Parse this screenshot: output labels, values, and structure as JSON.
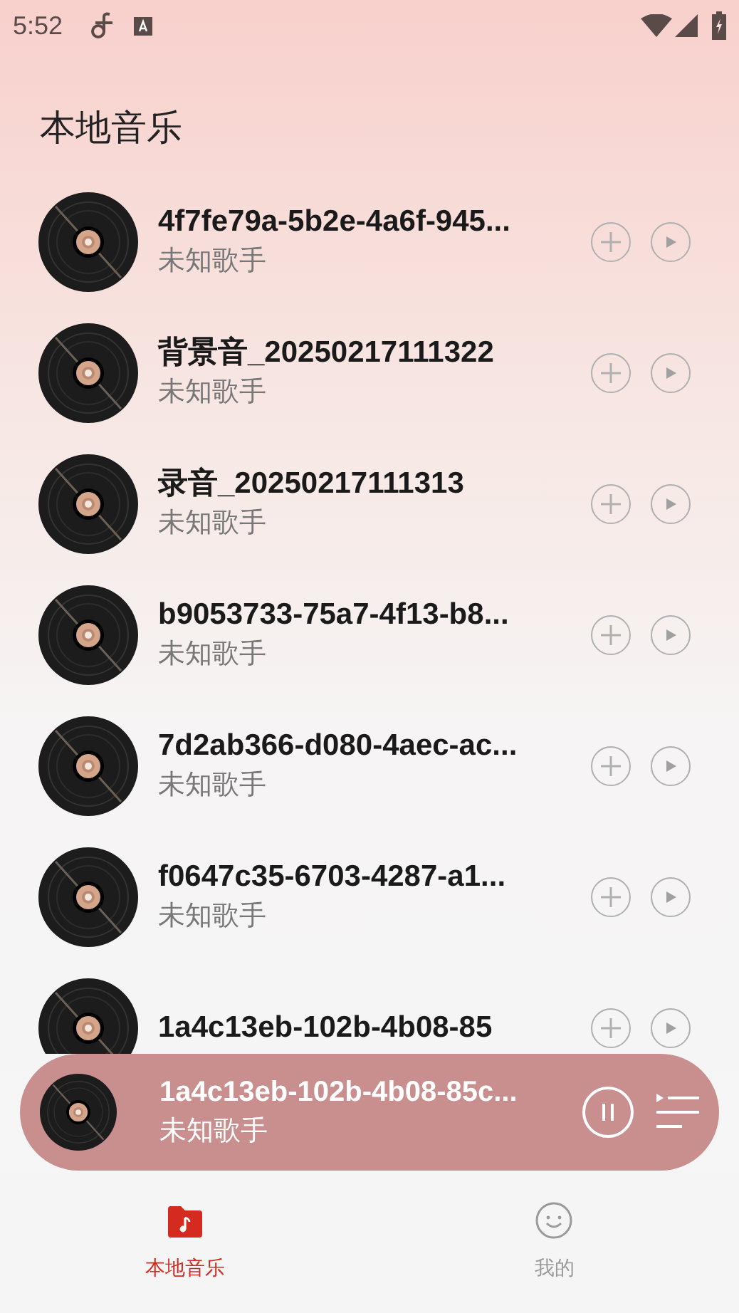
{
  "status_bar": {
    "time": "5:52"
  },
  "header": {
    "title": "本地音乐"
  },
  "songs": [
    {
      "title": "4f7fe79a-5b2e-4a6f-945...",
      "artist": "未知歌手"
    },
    {
      "title": "背景音_20250217111322",
      "artist": "未知歌手"
    },
    {
      "title": "录音_20250217111313",
      "artist": "未知歌手"
    },
    {
      "title": "b9053733-75a7-4f13-b8...",
      "artist": "未知歌手"
    },
    {
      "title": "7d2ab366-d080-4aec-ac...",
      "artist": "未知歌手"
    },
    {
      "title": "f0647c35-6703-4287-a1...",
      "artist": "未知歌手"
    },
    {
      "title": "1a4c13eb-102b-4b08-85"
    }
  ],
  "player": {
    "title": "1a4c13eb-102b-4b08-85c...",
    "artist": "未知歌手",
    "playing": true
  },
  "tabs": [
    {
      "label": "本地音乐",
      "kind": "folder",
      "selected": true
    },
    {
      "label": "我的",
      "kind": "smile",
      "selected": false
    }
  ]
}
